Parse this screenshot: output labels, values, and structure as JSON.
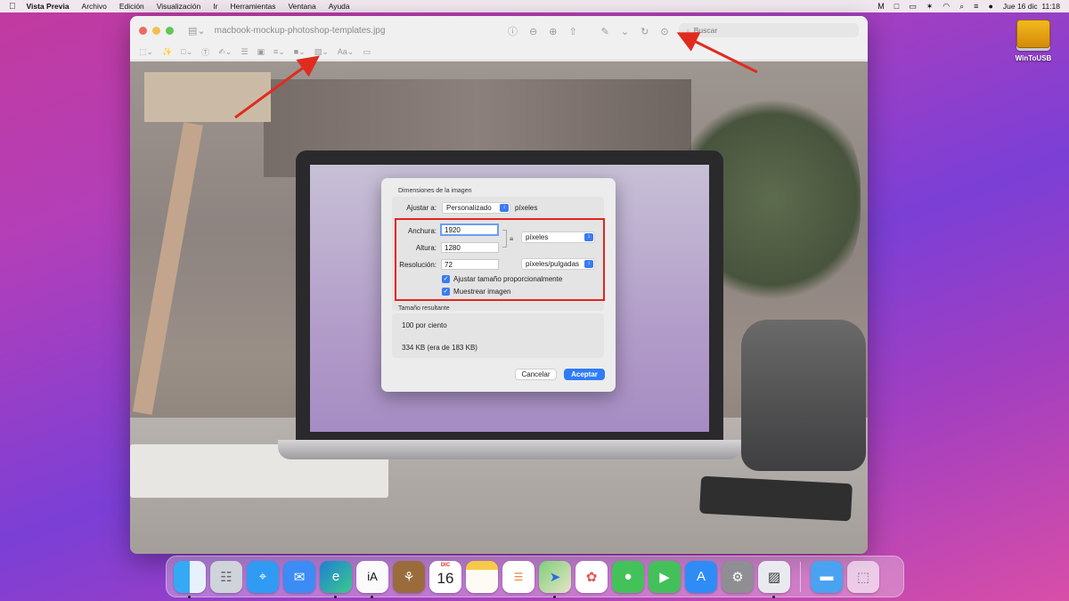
{
  "menubar": {
    "app_name": "Vista Previa",
    "menus": [
      "Archivo",
      "Edición",
      "Visualización",
      "Ir",
      "Herramientas",
      "Ventana",
      "Ayuda"
    ],
    "clock": "Jue 16 dic  11:18",
    "icons": [
      "apple-icon",
      "gmail-icon",
      "display-icon",
      "battery-icon",
      "bluetooth-icon",
      "wifi-icon",
      "search-icon",
      "control-center-icon",
      "siri-icon"
    ]
  },
  "desktop": {
    "drive_label": "WinToUSB"
  },
  "window": {
    "title": "macbook-mockup-photoshop-templates.jpg",
    "search_placeholder": "Buscar",
    "markup_font_label": "Aa"
  },
  "dialog": {
    "section_dimensions": "Dimensiones de la imagen",
    "fit_label": "Ajustar a:",
    "fit_value": "Personalizado",
    "fit_unit": "píxeles",
    "width_label": "Anchura:",
    "width_value": "1920",
    "height_label": "Altura:",
    "height_value": "1280",
    "resolution_label": "Resolución:",
    "resolution_value": "72",
    "size_unit": "píxeles",
    "resolution_unit": "píxeles/pulgadas",
    "scale_proportionally": "Ajustar tamaño proporcionalmente",
    "resample": "Muestrear imagen",
    "section_result": "Tamaño resultante",
    "result_percent": "100 por ciento",
    "result_size": "334 KB (era de 183 KB)",
    "cancel_label": "Cancelar",
    "ok_label": "Aceptar"
  },
  "dock": {
    "calendar_month": "DIC",
    "calendar_day": "16",
    "icons": [
      "finder-icon",
      "launchpad-icon",
      "safari-icon",
      "mail-icon",
      "edge-icon",
      "ia-writer-icon",
      "notefile-icon",
      "calendar-icon",
      "notes-icon",
      "reminders-icon",
      "maps-icon",
      "photos-icon",
      "messages-icon",
      "facetime-icon",
      "app-store-icon",
      "system-preferences-icon",
      "preview-icon",
      "folder-icon",
      "trash-icon"
    ]
  },
  "colors": {
    "accent_blue": "#2f7cf6",
    "highlight_red": "#e5241e",
    "arrow_red": "#e02b1f"
  }
}
